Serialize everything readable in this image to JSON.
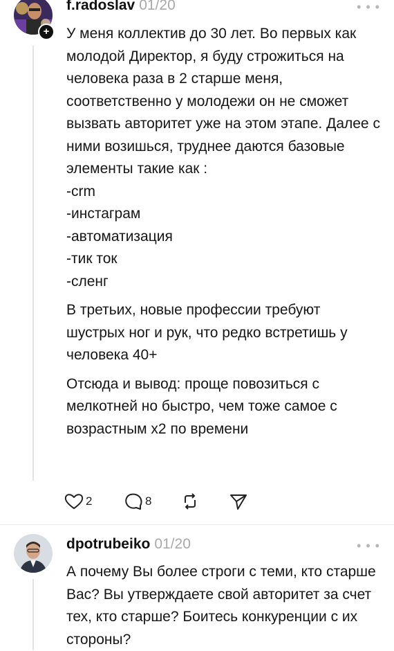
{
  "post1": {
    "username": "f.radoslav",
    "date": "01/20",
    "paragraphs": [
      "У меня коллектив до 30 лет. Во первых как молодой Директор, я буду строжиться на человека раза в 2 старше меня, соответственно у молодежи он не сможет вызвать авторитет уже на этом этапе. Далее с ними возишься, труднее даются базовые элементы такие как :\n-crm\n-инстаграм\n-автоматизация\n-тик ток\n-сленг",
      "В третьих, новые профессии требуют шустрых ног и рук, что редко встретишь у человека 40+",
      "Отсюда и вывод: проще повозиться с мелкотней но быстро, чем тоже самое с возрастным х2 по времени"
    ],
    "likes": "2",
    "comments": "8",
    "follow_icon": "plus-icon"
  },
  "post2": {
    "username": "dpotrubeiko",
    "date": "01/20",
    "text": "А почему Вы более строги с теми, кто старше Вас? Вы утверждаете свой авторитет за счет тех, кто старше? Боитесь конкуренции с их стороны?"
  },
  "more_label": "• • •",
  "follow_label": "+"
}
